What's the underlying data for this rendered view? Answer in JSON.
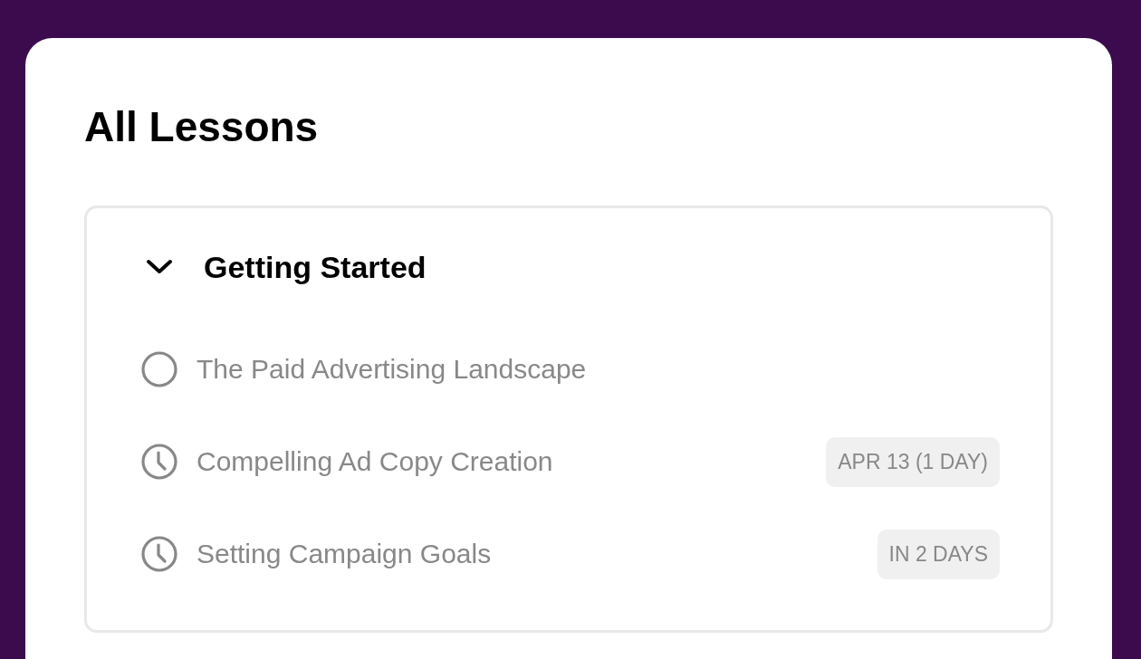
{
  "page": {
    "title": "All Lessons"
  },
  "sections": [
    {
      "title": "Getting Started",
      "expanded": true,
      "lessons": [
        {
          "kind": "unstarted",
          "title": "The Paid Advertising Landscape"
        },
        {
          "kind": "scheduled",
          "title": "Compelling Ad Copy Creation",
          "badge": "APR 13 (1 DAY)"
        },
        {
          "kind": "scheduled",
          "title": "Setting Campaign Goals",
          "badge": "IN 2 DAYS"
        }
      ]
    }
  ]
}
